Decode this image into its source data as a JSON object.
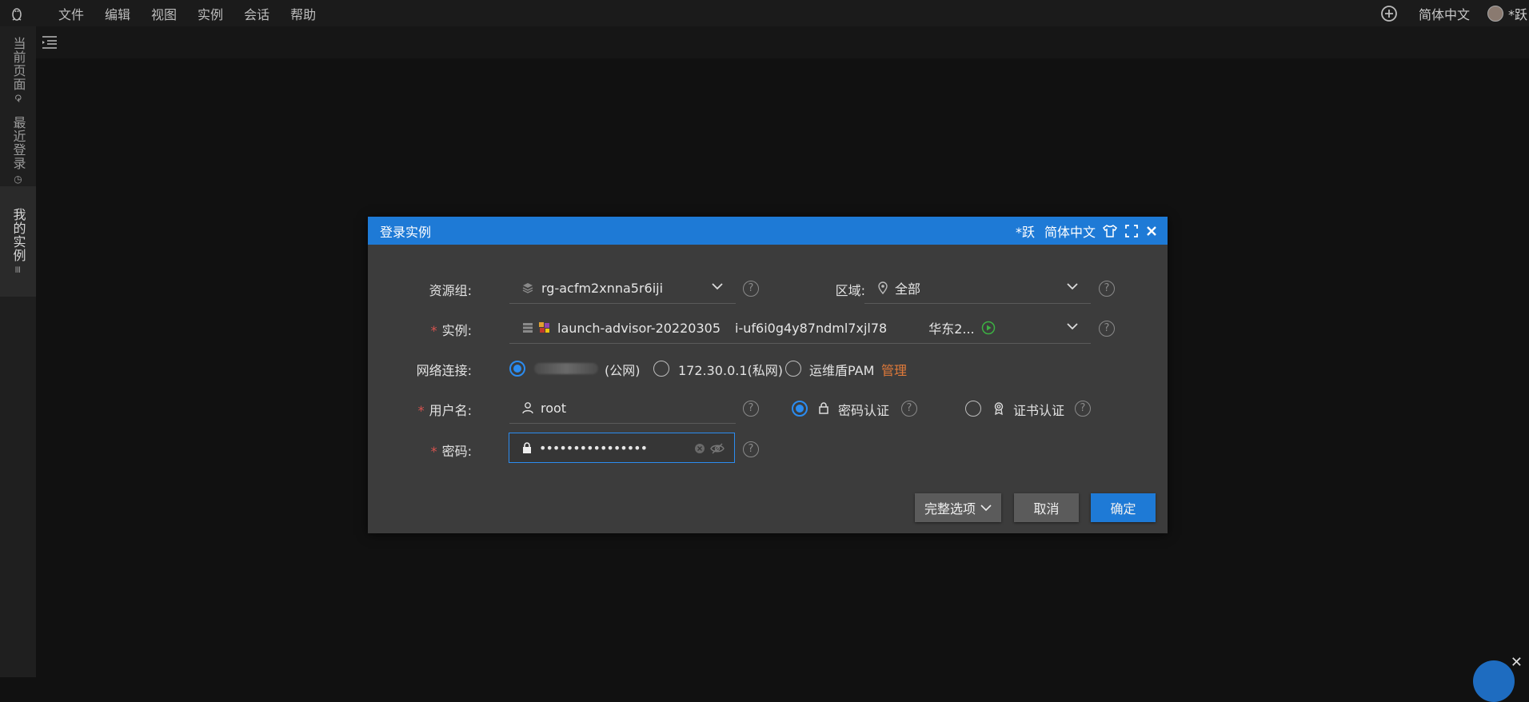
{
  "menubar": {
    "items": [
      "文件",
      "编辑",
      "视图",
      "实例",
      "会话",
      "帮助"
    ],
    "language": "简体中文",
    "user": "*跃"
  },
  "sidebar": {
    "tabs": [
      "当前页面",
      "最近登录",
      "我的实例"
    ]
  },
  "dialog": {
    "title": "登录实例",
    "user": "*跃",
    "language": "简体中文",
    "resource_group": {
      "label": "资源组:",
      "value": "rg-acfm2xnna5r6iji"
    },
    "region": {
      "label": "区域:",
      "value": "全部"
    },
    "instance": {
      "label": "实例:",
      "name": "launch-advisor-20220305",
      "id": "i-uf6i0g4y87ndml7xjl78",
      "zone": "华东2..."
    },
    "network": {
      "label": "网络连接:",
      "public": "(公网)",
      "private": "172.30.0.1(私网)",
      "pam": "运维盾PAM",
      "manage": "管理"
    },
    "username": {
      "label": "用户名:",
      "value": "root"
    },
    "auth": {
      "password": "密码认证",
      "cert": "证书认证"
    },
    "password": {
      "label": "密码:",
      "value": "••••••••••••••••"
    },
    "buttons": {
      "options": "完整选项",
      "cancel": "取消",
      "ok": "确定"
    }
  },
  "colors": {
    "accent": "#1e7ad6",
    "radio": "#2b8cf0",
    "link": "#e07a3a",
    "required": "#d9534f"
  }
}
